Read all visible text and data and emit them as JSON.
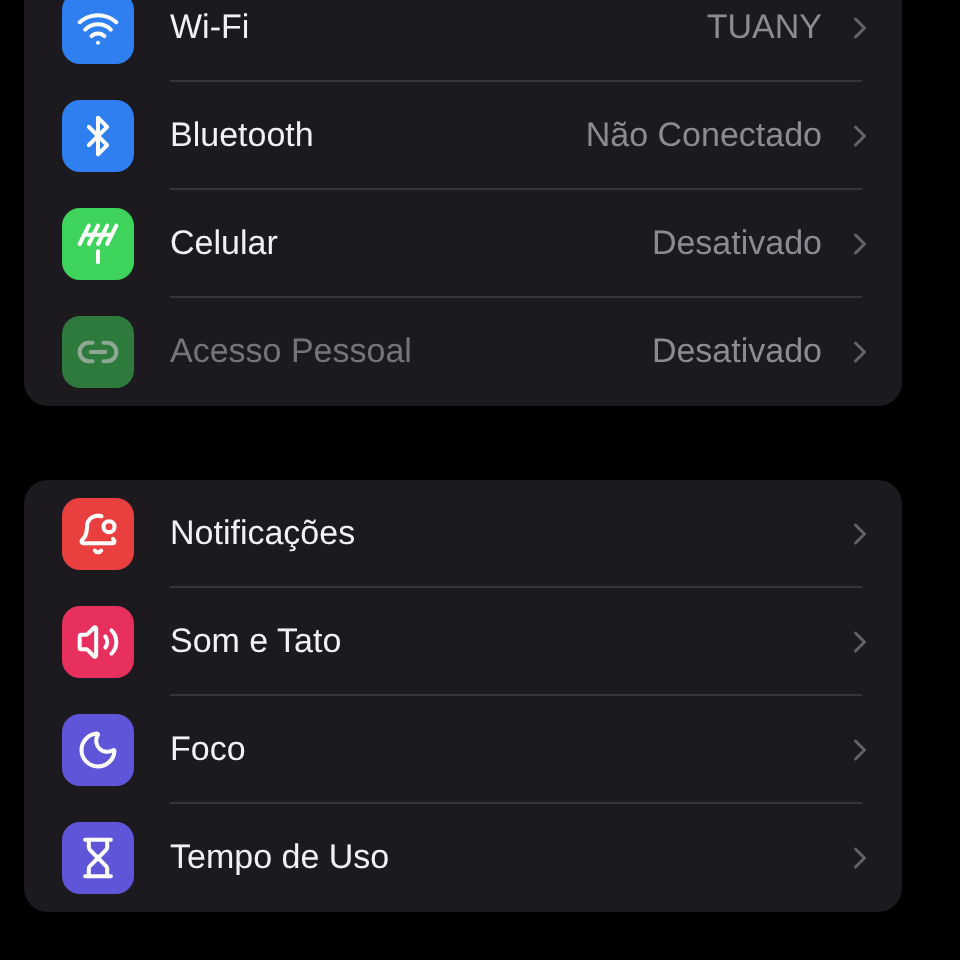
{
  "groups": [
    {
      "items": [
        {
          "color": "#2f7ff0",
          "label": "Wi-Fi",
          "value": "TUANY",
          "disabled": false
        },
        {
          "color": "#2f7ff0",
          "label": "Bluetooth",
          "value": "Não Conectado",
          "disabled": false
        },
        {
          "color": "#3ed35a",
          "label": "Celular",
          "value": "Desativado",
          "disabled": false
        },
        {
          "color": "#2e7a3d",
          "label": "Acesso Pessoal",
          "value": "Desativado",
          "disabled": true
        }
      ]
    },
    {
      "items": [
        {
          "color": "#e9403f",
          "label": "Notificações",
          "disabled": false
        },
        {
          "color": "#e8305f",
          "label": "Som e Tato",
          "disabled": false
        },
        {
          "color": "#5e55d8",
          "label": "Foco",
          "disabled": false
        },
        {
          "color": "#5e55d8",
          "label": "Tempo de Uso",
          "disabled": false
        }
      ]
    }
  ]
}
